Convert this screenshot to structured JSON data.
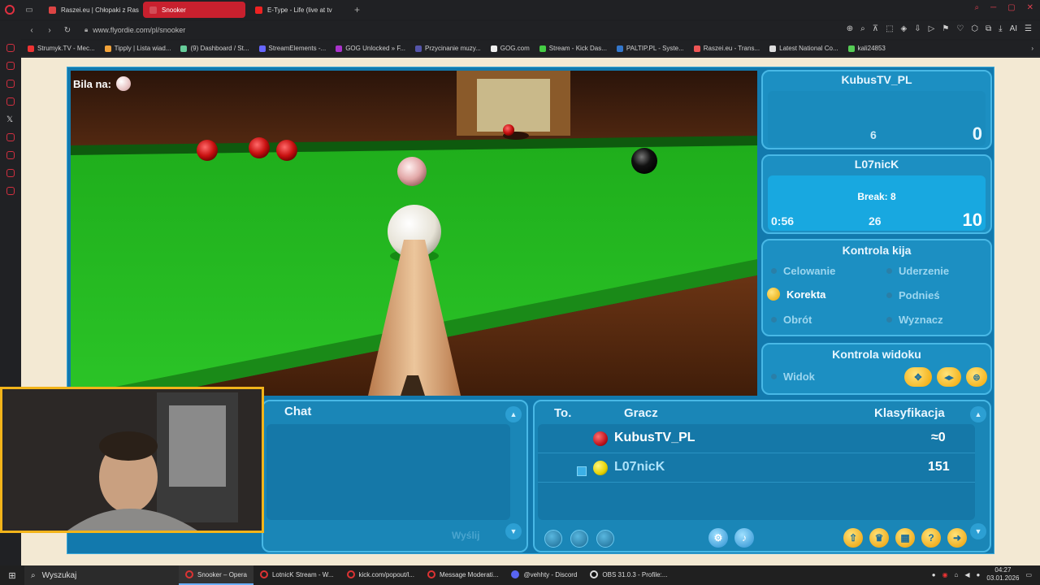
{
  "browser": {
    "tabs": [
      {
        "label": "Raszei.eu | Chłopaki z Ras",
        "active": false
      },
      {
        "label": "Snooker",
        "active": true
      },
      {
        "label": "E-Type - Life (live at tv",
        "active": false
      }
    ],
    "url": "www.flyordie.com/pl/snooker",
    "bookmarks": [
      "Strumyk.TV - Mec...",
      "Tipply | Lista wiad...",
      "(9) Dashboard / St...",
      "StreamElements -...",
      "GOG Unlocked » F...",
      "Przycinanie muzy...",
      "GOG.com",
      "Stream - Kick Das...",
      "PALTIP.PL - Syste...",
      "Raszei.eu - Trans...",
      "Latest National Co...",
      "kali24853"
    ],
    "ai_label": "AI"
  },
  "game": {
    "bila_label": "Bila na:",
    "player1": {
      "name": "KubusTV_PL",
      "frames": "6",
      "score": "0"
    },
    "player2": {
      "name": "L07nicK",
      "break": "Break: 8",
      "timer": "0:56",
      "frames": "26",
      "score": "10"
    },
    "cue_control": {
      "title": "Kontrola kija",
      "items": [
        {
          "label": "Celowanie",
          "active": false
        },
        {
          "label": "Uderzenie",
          "active": false
        },
        {
          "label": "Korekta",
          "active": true
        },
        {
          "label": "Podnieś",
          "active": false
        },
        {
          "label": "Obrót",
          "active": false
        },
        {
          "label": "Wyznacz",
          "active": false
        }
      ]
    },
    "view_control": {
      "title": "Kontrola widoku",
      "item": "Widok"
    },
    "chat": {
      "title": "Chat",
      "send": "Wyślij"
    },
    "ranking": {
      "col_turn": "To.",
      "col_player": "Gracz",
      "col_rank": "Klasyfikacja",
      "rows": [
        {
          "name": "KubusTV_PL",
          "rank": "≈0",
          "ball_color": "#c0141e"
        },
        {
          "name": "L07nicK",
          "rank": "151",
          "ball_color": "#e6d200"
        }
      ]
    }
  },
  "taskbar": {
    "search": "Wyszukaj",
    "apps": [
      {
        "label": "Snooker – Opera",
        "active": true
      },
      {
        "label": "LotnicK Stream - W...",
        "active": false
      },
      {
        "label": "kick.com/popout/l...",
        "active": false
      },
      {
        "label": "Message Moderati...",
        "active": false
      },
      {
        "label": "@vehhty - Discord",
        "active": false
      },
      {
        "label": "OBS 31.0.3 - Profile:...",
        "active": false
      }
    ],
    "time": "04:27",
    "date": "03.01.2026"
  }
}
